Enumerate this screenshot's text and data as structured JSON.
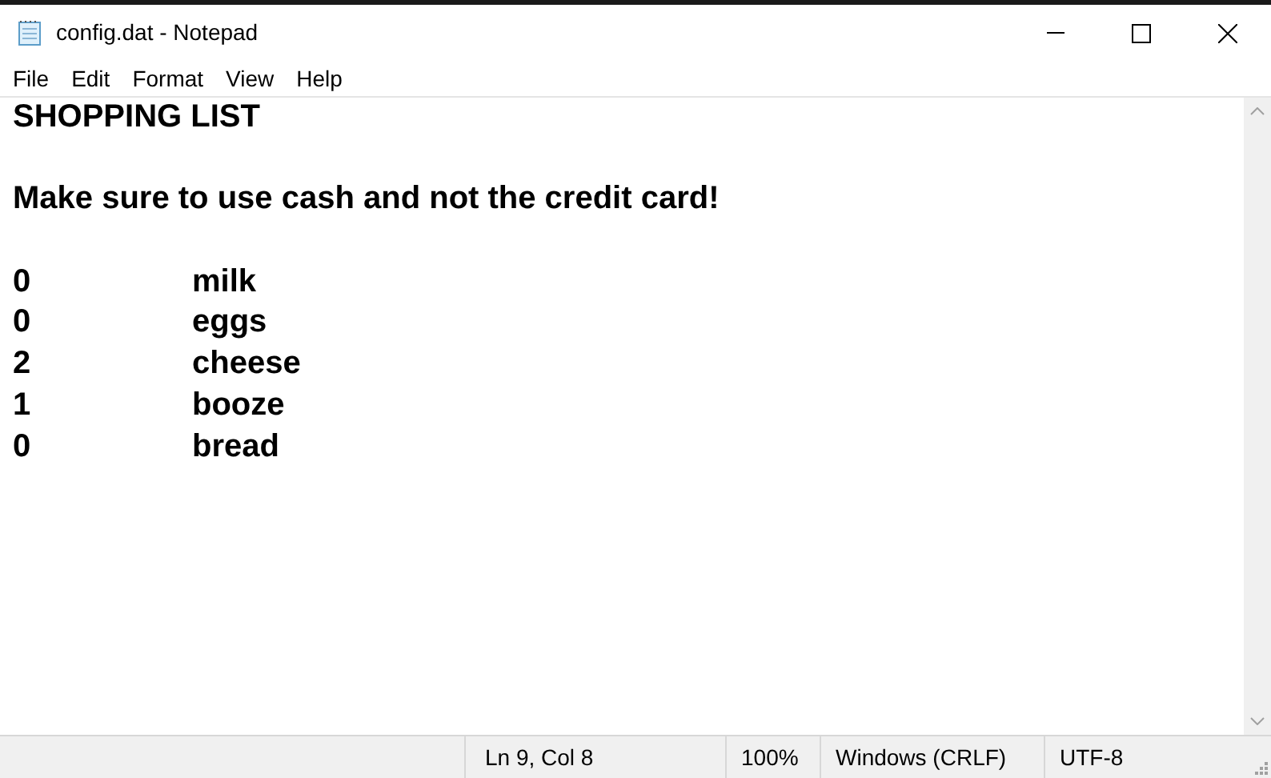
{
  "window": {
    "title": "config.dat - Notepad"
  },
  "menu": [
    "File",
    "Edit",
    "Format",
    "View",
    "Help"
  ],
  "document": {
    "heading": "SHOPPING LIST",
    "note": "Make sure to use cash and not the credit card!",
    "items": [
      {
        "qty": "0",
        "name": "milk"
      },
      {
        "qty": "0",
        "name": "eggs"
      },
      {
        "qty": "2",
        "name": "cheese"
      },
      {
        "qty": "1",
        "name": "booze"
      },
      {
        "qty": "0",
        "name": "bread"
      }
    ]
  },
  "status_bar": {
    "position": "Ln 9, Col 8",
    "zoom": "100%",
    "line_endings": "Windows (CRLF)",
    "encoding": "UTF-8"
  }
}
